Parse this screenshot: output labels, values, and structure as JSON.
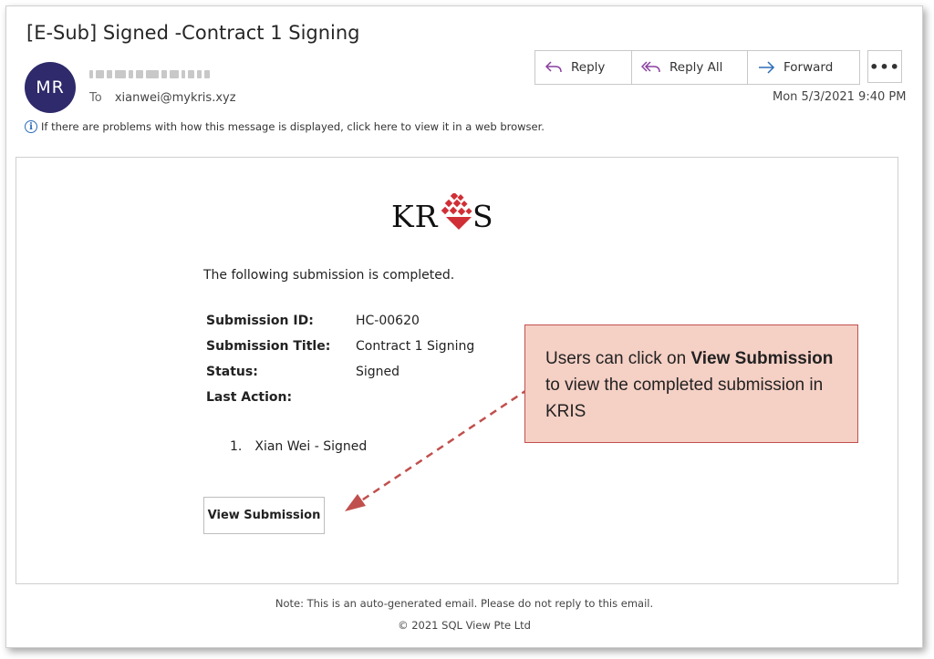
{
  "email": {
    "subject": "[E-Sub] Signed -Contract 1 Signing",
    "avatar_initials": "MR",
    "to_label": "To",
    "to_address": "xianwei@mykris.xyz",
    "date": "Mon 5/3/2021 9:40 PM",
    "info_message": "If there are problems with how this message is displayed, click here to view it in a web browser."
  },
  "actions": {
    "reply": "Reply",
    "reply_all": "Reply All",
    "forward": "Forward",
    "more": "•••"
  },
  "body": {
    "logo_left": "KR",
    "logo_right": "S",
    "intro": "The following submission is completed.",
    "fields": [
      {
        "label": "Submission ID:",
        "value": "HC-00620"
      },
      {
        "label": "Submission Title:",
        "value": "Contract 1 Signing"
      },
      {
        "label": "Status:",
        "value": "Signed"
      },
      {
        "label": "Last Action:",
        "value": ""
      }
    ],
    "actions_list": [
      {
        "num": "1.",
        "text": "Xian Wei - Signed"
      }
    ],
    "view_button": "View Submission"
  },
  "callout": {
    "part1": "Users can click on ",
    "bold": "View Submission",
    "part2": " to view the completed submission in KRIS"
  },
  "footer": {
    "note": "Note: This is an auto-generated email. Please do not reply to this email.",
    "copyright": "© 2021 SQL View Pte Ltd"
  },
  "colors": {
    "avatar": "#2e2a6b",
    "reply_icon": "#8a3fa0",
    "forward_icon": "#2b6cb8",
    "callout_bg": "#f5d0c5",
    "callout_border": "#c0504d",
    "arrow": "#c0504d",
    "logo_accent": "#d02f36"
  }
}
